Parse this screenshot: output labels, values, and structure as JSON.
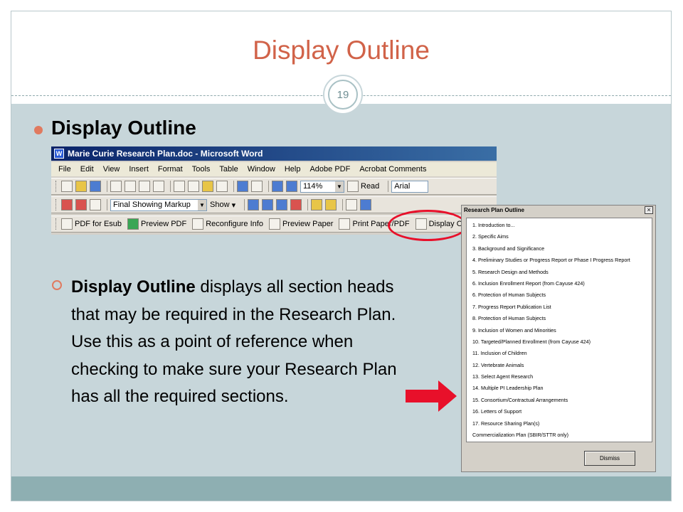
{
  "slide": {
    "title": "Display Outline",
    "page_number": "19",
    "bullet_heading": "Display Outline",
    "sub_bullet": {
      "bold": "Display Outline",
      "text": " displays all section heads that may be required in the Research Plan.  Use this as a point of reference when checking to make sure your Research Plan has all the required sections."
    },
    "colors": {
      "title": "#d16349",
      "accent": "#e07a5f",
      "body_bg": "#c7d6da",
      "footer": "#8eafb2",
      "circle": "#e8102a"
    }
  },
  "word": {
    "title": "Marie Curie Research Plan.doc - Microsoft Word",
    "menu": [
      "File",
      "Edit",
      "View",
      "Insert",
      "Format",
      "Tools",
      "Table",
      "Window",
      "Help",
      "Adobe PDF",
      "Acrobat Comments"
    ],
    "zoom": "114%",
    "read_label": "Read",
    "font": "Arial",
    "markup_mode": "Final Showing Markup",
    "show_label": "Show",
    "buttons": [
      "PDF for Esub",
      "Preview PDF",
      "Reconfigure Info",
      "Preview Paper",
      "Print Paper/PDF",
      "Display Outline"
    ]
  },
  "dialog": {
    "title": "Research Plan Outline",
    "close_label": "×",
    "items": [
      "1. Introduction to...",
      "2. Specific Aims",
      "3. Background and Significance",
      "4. Preliminary Studies or Progress Report or Phase I Progress Report",
      "5. Research Design and Methods",
      "6. Inclusion Enrollment Report  (from Cayuse 424)",
      "6. Protection of Human Subjects",
      "7. Progress Report Publication List",
      "8. Protection of Human Subjects",
      "9. Inclusion of Women and Minorities",
      "10. Targeted/Planned Enrollment (from Cayuse 424)",
      "11. Inclusion of Children",
      "12. Vertebrate Animals",
      "13. Select Agent Research",
      "14. Multiple PI Leadership Plan",
      "15. Consortium/Contractual Arrangements",
      "16. Letters of Support",
      "17. Resource Sharing Plan(s)",
      "Commercialization Plan (SBIR/STTR only)"
    ],
    "dismiss_label": "Dismiss"
  }
}
